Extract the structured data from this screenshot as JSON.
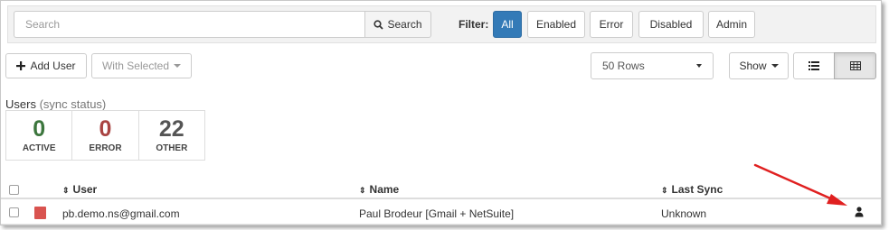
{
  "search": {
    "placeholder": "Search",
    "button_label": "Search"
  },
  "filter": {
    "label": "Filter:",
    "options": [
      "All",
      "Enabled",
      "Error",
      "Disabled",
      "Admin"
    ],
    "selected": "All"
  },
  "toolbar": {
    "add_user_label": "Add User",
    "with_selected_label": "With Selected",
    "rows_select_value": "50 Rows",
    "show_label": "Show"
  },
  "stats": {
    "title": "Users",
    "subtitle": "(sync status)",
    "items": [
      {
        "value": "0",
        "label": "ACTIVE",
        "color": "#3c763d"
      },
      {
        "value": "0",
        "label": "ERROR",
        "color": "#a94442"
      },
      {
        "value": "22",
        "label": "OTHER",
        "color": "#555555"
      }
    ]
  },
  "table": {
    "columns": [
      "User",
      "Name",
      "Last Sync"
    ],
    "rows": [
      {
        "user": "pb.demo.ns@gmail.com",
        "name": "Paul Brodeur [Gmail + NetSuite]",
        "last_sync": "Unknown",
        "status_color": "#d9534f"
      }
    ]
  },
  "colors": {
    "accent": "#337ab7",
    "annotation_arrow": "#e02020"
  }
}
